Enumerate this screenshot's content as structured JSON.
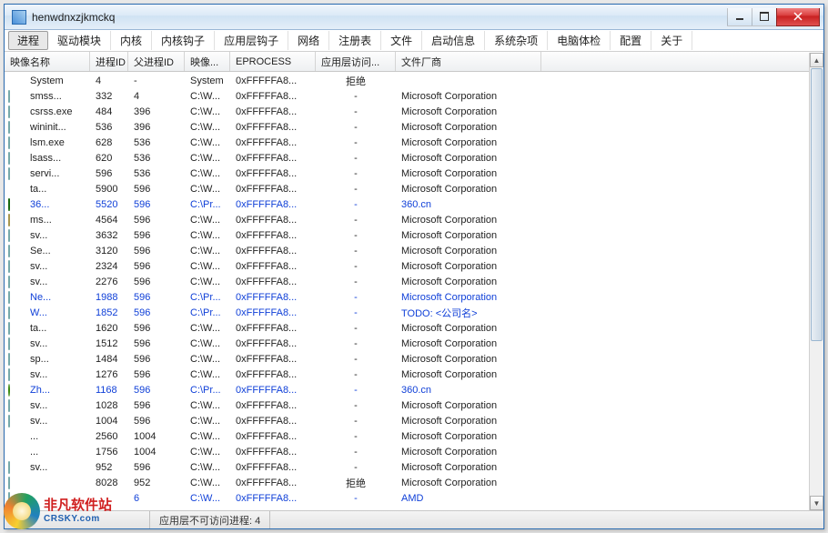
{
  "window": {
    "title": "henwdnxzjkmckq"
  },
  "menu": [
    "进程",
    "驱动模块",
    "内核",
    "内核钩子",
    "应用层钩子",
    "网络",
    "注册表",
    "文件",
    "启动信息",
    "系统杂项",
    "电脑体检",
    "配置",
    "关于"
  ],
  "columns": [
    "映像名称",
    "进程ID",
    "父进程ID",
    "映像...",
    "EPROCESS",
    "应用层访问...",
    "文件厂商"
  ],
  "rows": [
    {
      "icon": "none",
      "blue": false,
      "name": "System",
      "pid": "4",
      "ppid": "-",
      "path": "System",
      "ep": "0xFFFFFA8...",
      "acc": "拒绝",
      "vendor": ""
    },
    {
      "icon": "default",
      "blue": false,
      "name": "smss...",
      "pid": "332",
      "ppid": "4",
      "path": "C:\\W...",
      "ep": "0xFFFFFA8...",
      "acc": "-",
      "vendor": "Microsoft Corporation"
    },
    {
      "icon": "default",
      "blue": false,
      "name": "csrss.exe",
      "pid": "484",
      "ppid": "396",
      "path": "C:\\W...",
      "ep": "0xFFFFFA8...",
      "acc": "-",
      "vendor": "Microsoft Corporation"
    },
    {
      "icon": "default",
      "blue": false,
      "name": "wininit...",
      "pid": "536",
      "ppid": "396",
      "path": "C:\\W...",
      "ep": "0xFFFFFA8...",
      "acc": "-",
      "vendor": "Microsoft Corporation"
    },
    {
      "icon": "default",
      "blue": false,
      "name": "lsm.exe",
      "pid": "628",
      "ppid": "536",
      "path": "C:\\W...",
      "ep": "0xFFFFFA8...",
      "acc": "-",
      "vendor": "Microsoft Corporation"
    },
    {
      "icon": "default",
      "blue": false,
      "name": "lsass...",
      "pid": "620",
      "ppid": "536",
      "path": "C:\\W...",
      "ep": "0xFFFFFA8...",
      "acc": "-",
      "vendor": "Microsoft Corporation"
    },
    {
      "icon": "default",
      "blue": false,
      "name": "servi...",
      "pid": "596",
      "ppid": "536",
      "path": "C:\\W...",
      "ep": "0xFFFFFA8...",
      "acc": "-",
      "vendor": "Microsoft Corporation"
    },
    {
      "icon": "none",
      "blue": false,
      "name": "ta...",
      "pid": "5900",
      "ppid": "596",
      "path": "C:\\W...",
      "ep": "0xFFFFFA8...",
      "acc": "-",
      "vendor": "Microsoft Corporation"
    },
    {
      "icon": "shield",
      "blue": true,
      "name": "36...",
      "pid": "5520",
      "ppid": "596",
      "path": "C:\\Pr...",
      "ep": "0xFFFFFA8...",
      "acc": "-",
      "vendor": "360.cn"
    },
    {
      "icon": "doc",
      "blue": false,
      "name": "ms...",
      "pid": "4564",
      "ppid": "596",
      "path": "C:\\W...",
      "ep": "0xFFFFFA8...",
      "acc": "-",
      "vendor": "Microsoft Corporation"
    },
    {
      "icon": "default",
      "blue": false,
      "name": "sv...",
      "pid": "3632",
      "ppid": "596",
      "path": "C:\\W...",
      "ep": "0xFFFFFA8...",
      "acc": "-",
      "vendor": "Microsoft Corporation"
    },
    {
      "icon": "default",
      "blue": false,
      "name": "Se...",
      "pid": "3120",
      "ppid": "596",
      "path": "C:\\W...",
      "ep": "0xFFFFFA8...",
      "acc": "-",
      "vendor": "Microsoft Corporation"
    },
    {
      "icon": "default",
      "blue": false,
      "name": "sv...",
      "pid": "2324",
      "ppid": "596",
      "path": "C:\\W...",
      "ep": "0xFFFFFA8...",
      "acc": "-",
      "vendor": "Microsoft Corporation"
    },
    {
      "icon": "default",
      "blue": false,
      "name": "sv...",
      "pid": "2276",
      "ppid": "596",
      "path": "C:\\W...",
      "ep": "0xFFFFFA8...",
      "acc": "-",
      "vendor": "Microsoft Corporation"
    },
    {
      "icon": "default",
      "blue": true,
      "name": "Ne...",
      "pid": "1988",
      "ppid": "596",
      "path": "C:\\Pr...",
      "ep": "0xFFFFFA8...",
      "acc": "-",
      "vendor": "Microsoft Corporation"
    },
    {
      "icon": "default",
      "blue": true,
      "name": "W...",
      "pid": "1852",
      "ppid": "596",
      "path": "C:\\Pr...",
      "ep": "0xFFFFFA8...",
      "acc": "-",
      "vendor": "TODO: <公司名>"
    },
    {
      "icon": "default",
      "blue": false,
      "name": "ta...",
      "pid": "1620",
      "ppid": "596",
      "path": "C:\\W...",
      "ep": "0xFFFFFA8...",
      "acc": "-",
      "vendor": "Microsoft Corporation"
    },
    {
      "icon": "default",
      "blue": false,
      "name": "sv...",
      "pid": "1512",
      "ppid": "596",
      "path": "C:\\W...",
      "ep": "0xFFFFFA8...",
      "acc": "-",
      "vendor": "Microsoft Corporation"
    },
    {
      "icon": "default",
      "blue": false,
      "name": "sp...",
      "pid": "1484",
      "ppid": "596",
      "path": "C:\\W...",
      "ep": "0xFFFFFA8...",
      "acc": "-",
      "vendor": "Microsoft Corporation"
    },
    {
      "icon": "default",
      "blue": false,
      "name": "sv...",
      "pid": "1276",
      "ppid": "596",
      "path": "C:\\W...",
      "ep": "0xFFFFFA8...",
      "acc": "-",
      "vendor": "Microsoft Corporation"
    },
    {
      "icon": "green",
      "blue": true,
      "name": "Zh...",
      "pid": "1168",
      "ppid": "596",
      "path": "C:\\Pr...",
      "ep": "0xFFFFFA8...",
      "acc": "-",
      "vendor": "360.cn"
    },
    {
      "icon": "default",
      "blue": false,
      "name": "sv...",
      "pid": "1028",
      "ppid": "596",
      "path": "C:\\W...",
      "ep": "0xFFFFFA8...",
      "acc": "-",
      "vendor": "Microsoft Corporation"
    },
    {
      "icon": "default",
      "blue": false,
      "name": "sv...",
      "pid": "1004",
      "ppid": "596",
      "path": "C:\\W...",
      "ep": "0xFFFFFA8...",
      "acc": "-",
      "vendor": "Microsoft Corporation"
    },
    {
      "icon": "none",
      "blue": false,
      "name": "...",
      "pid": "2560",
      "ppid": "1004",
      "path": "C:\\W...",
      "ep": "0xFFFFFA8...",
      "acc": "-",
      "vendor": "Microsoft Corporation"
    },
    {
      "icon": "none",
      "blue": false,
      "name": "...",
      "pid": "1756",
      "ppid": "1004",
      "path": "C:\\W...",
      "ep": "0xFFFFFA8...",
      "acc": "-",
      "vendor": "Microsoft Corporation"
    },
    {
      "icon": "default",
      "blue": false,
      "name": "sv...",
      "pid": "952",
      "ppid": "596",
      "path": "C:\\W...",
      "ep": "0xFFFFFA8...",
      "acc": "-",
      "vendor": "Microsoft Corporation"
    },
    {
      "icon": "default",
      "blue": false,
      "name": "",
      "pid": "8028",
      "ppid": "952",
      "path": "C:\\W...",
      "ep": "0xFFFFFA8...",
      "acc": "拒绝",
      "vendor": "Microsoft Corporation"
    },
    {
      "icon": "default",
      "blue": true,
      "name": "",
      "pid": "",
      "ppid": "6",
      "path": "C:\\W...",
      "ep": "0xFFFFFA8...",
      "acc": "-",
      "vendor": "AMD"
    }
  ],
  "status": {
    "pane2": "应用层不可访问进程: 4"
  },
  "watermark": {
    "zh": "非凡软件站",
    "en": "CRSKY.com"
  }
}
